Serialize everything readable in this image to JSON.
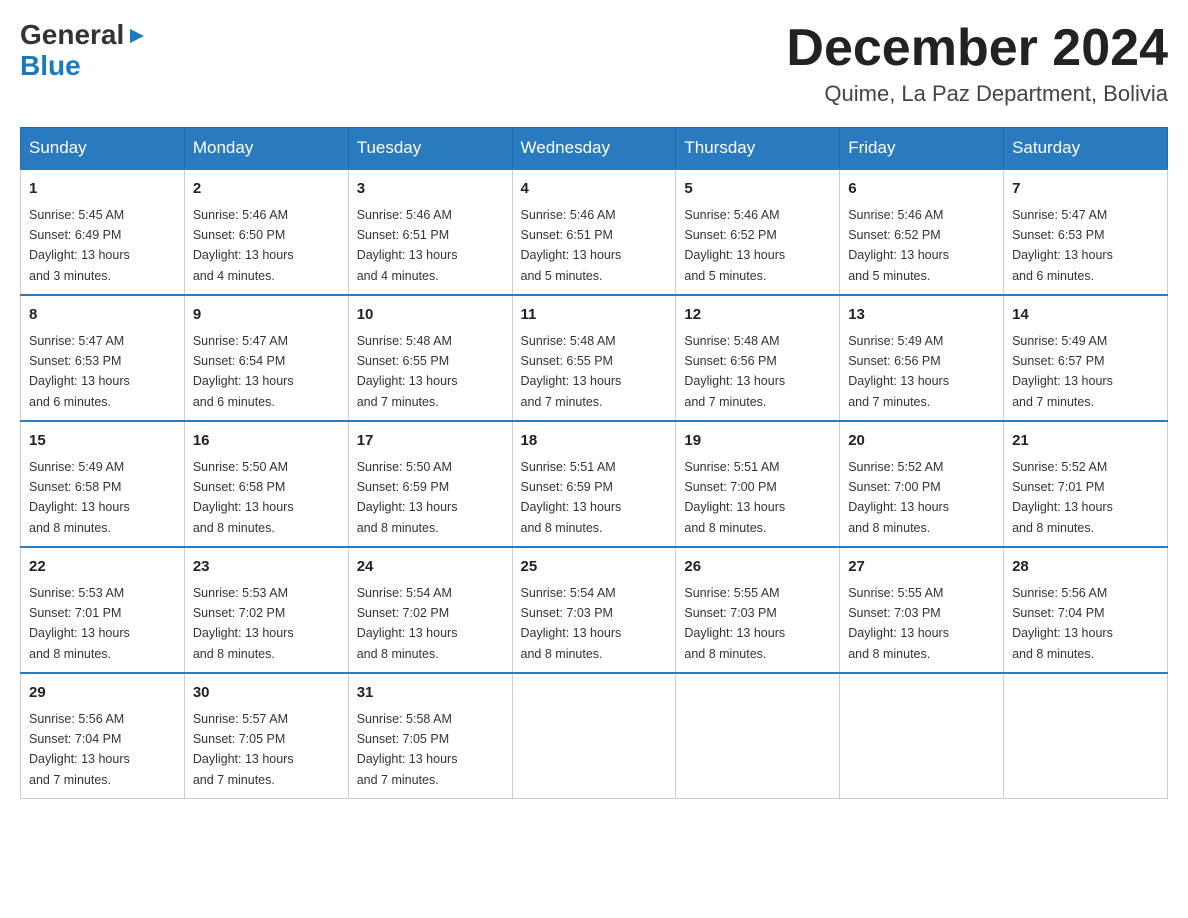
{
  "logo": {
    "general": "General",
    "blue": "Blue"
  },
  "header": {
    "title": "December 2024",
    "subtitle": "Quime, La Paz Department, Bolivia"
  },
  "weekdays": [
    "Sunday",
    "Monday",
    "Tuesday",
    "Wednesday",
    "Thursday",
    "Friday",
    "Saturday"
  ],
  "weeks": [
    [
      {
        "day": "1",
        "sunrise": "5:45 AM",
        "sunset": "6:49 PM",
        "daylight": "13 hours and 3 minutes."
      },
      {
        "day": "2",
        "sunrise": "5:46 AM",
        "sunset": "6:50 PM",
        "daylight": "13 hours and 4 minutes."
      },
      {
        "day": "3",
        "sunrise": "5:46 AM",
        "sunset": "6:51 PM",
        "daylight": "13 hours and 4 minutes."
      },
      {
        "day": "4",
        "sunrise": "5:46 AM",
        "sunset": "6:51 PM",
        "daylight": "13 hours and 5 minutes."
      },
      {
        "day": "5",
        "sunrise": "5:46 AM",
        "sunset": "6:52 PM",
        "daylight": "13 hours and 5 minutes."
      },
      {
        "day": "6",
        "sunrise": "5:46 AM",
        "sunset": "6:52 PM",
        "daylight": "13 hours and 5 minutes."
      },
      {
        "day": "7",
        "sunrise": "5:47 AM",
        "sunset": "6:53 PM",
        "daylight": "13 hours and 6 minutes."
      }
    ],
    [
      {
        "day": "8",
        "sunrise": "5:47 AM",
        "sunset": "6:53 PM",
        "daylight": "13 hours and 6 minutes."
      },
      {
        "day": "9",
        "sunrise": "5:47 AM",
        "sunset": "6:54 PM",
        "daylight": "13 hours and 6 minutes."
      },
      {
        "day": "10",
        "sunrise": "5:48 AM",
        "sunset": "6:55 PM",
        "daylight": "13 hours and 7 minutes."
      },
      {
        "day": "11",
        "sunrise": "5:48 AM",
        "sunset": "6:55 PM",
        "daylight": "13 hours and 7 minutes."
      },
      {
        "day": "12",
        "sunrise": "5:48 AM",
        "sunset": "6:56 PM",
        "daylight": "13 hours and 7 minutes."
      },
      {
        "day": "13",
        "sunrise": "5:49 AM",
        "sunset": "6:56 PM",
        "daylight": "13 hours and 7 minutes."
      },
      {
        "day": "14",
        "sunrise": "5:49 AM",
        "sunset": "6:57 PM",
        "daylight": "13 hours and 7 minutes."
      }
    ],
    [
      {
        "day": "15",
        "sunrise": "5:49 AM",
        "sunset": "6:58 PM",
        "daylight": "13 hours and 8 minutes."
      },
      {
        "day": "16",
        "sunrise": "5:50 AM",
        "sunset": "6:58 PM",
        "daylight": "13 hours and 8 minutes."
      },
      {
        "day": "17",
        "sunrise": "5:50 AM",
        "sunset": "6:59 PM",
        "daylight": "13 hours and 8 minutes."
      },
      {
        "day": "18",
        "sunrise": "5:51 AM",
        "sunset": "6:59 PM",
        "daylight": "13 hours and 8 minutes."
      },
      {
        "day": "19",
        "sunrise": "5:51 AM",
        "sunset": "7:00 PM",
        "daylight": "13 hours and 8 minutes."
      },
      {
        "day": "20",
        "sunrise": "5:52 AM",
        "sunset": "7:00 PM",
        "daylight": "13 hours and 8 minutes."
      },
      {
        "day": "21",
        "sunrise": "5:52 AM",
        "sunset": "7:01 PM",
        "daylight": "13 hours and 8 minutes."
      }
    ],
    [
      {
        "day": "22",
        "sunrise": "5:53 AM",
        "sunset": "7:01 PM",
        "daylight": "13 hours and 8 minutes."
      },
      {
        "day": "23",
        "sunrise": "5:53 AM",
        "sunset": "7:02 PM",
        "daylight": "13 hours and 8 minutes."
      },
      {
        "day": "24",
        "sunrise": "5:54 AM",
        "sunset": "7:02 PM",
        "daylight": "13 hours and 8 minutes."
      },
      {
        "day": "25",
        "sunrise": "5:54 AM",
        "sunset": "7:03 PM",
        "daylight": "13 hours and 8 minutes."
      },
      {
        "day": "26",
        "sunrise": "5:55 AM",
        "sunset": "7:03 PM",
        "daylight": "13 hours and 8 minutes."
      },
      {
        "day": "27",
        "sunrise": "5:55 AM",
        "sunset": "7:03 PM",
        "daylight": "13 hours and 8 minutes."
      },
      {
        "day": "28",
        "sunrise": "5:56 AM",
        "sunset": "7:04 PM",
        "daylight": "13 hours and 8 minutes."
      }
    ],
    [
      {
        "day": "29",
        "sunrise": "5:56 AM",
        "sunset": "7:04 PM",
        "daylight": "13 hours and 7 minutes."
      },
      {
        "day": "30",
        "sunrise": "5:57 AM",
        "sunset": "7:05 PM",
        "daylight": "13 hours and 7 minutes."
      },
      {
        "day": "31",
        "sunrise": "5:58 AM",
        "sunset": "7:05 PM",
        "daylight": "13 hours and 7 minutes."
      },
      null,
      null,
      null,
      null
    ]
  ],
  "labels": {
    "sunrise": "Sunrise:",
    "sunset": "Sunset:",
    "daylight": "Daylight:"
  }
}
